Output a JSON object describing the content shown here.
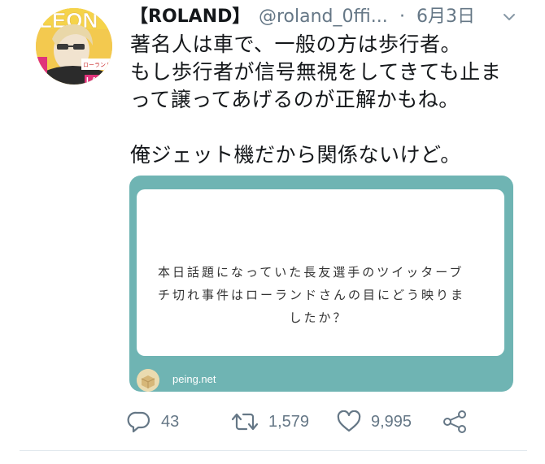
{
  "tweet": {
    "display_name": "【ROLAND】",
    "handle": "@roland_0ffi...",
    "separator": "·",
    "date": "6月3日",
    "text_lines": [
      "著名人は車で、一般の方は歩行者。",
      "もし歩行者が信号無視をしてきても止ま",
      "って譲ってあげるのが正解かもね。",
      "",
      "俺ジェット機だから関係ないけど。"
    ]
  },
  "card": {
    "question_lines": [
      "本日話題になっていた長友選手のツイッターブ",
      "チ切れ事件はローランドさんの目にどう映りま",
      "したか？"
    ],
    "domain": "peing.net",
    "colors": {
      "frame": "#6fb4b3",
      "inner": "#ffffff"
    }
  },
  "actions": {
    "reply_count": "43",
    "retweet_count": "1,579",
    "like_count": "9,995",
    "icons": [
      "reply-icon",
      "retweet-icon",
      "like-icon",
      "share-icon"
    ]
  },
  "colors": {
    "text": "#14171a",
    "secondary": "#657786",
    "divider": "#e1e8ed"
  }
}
